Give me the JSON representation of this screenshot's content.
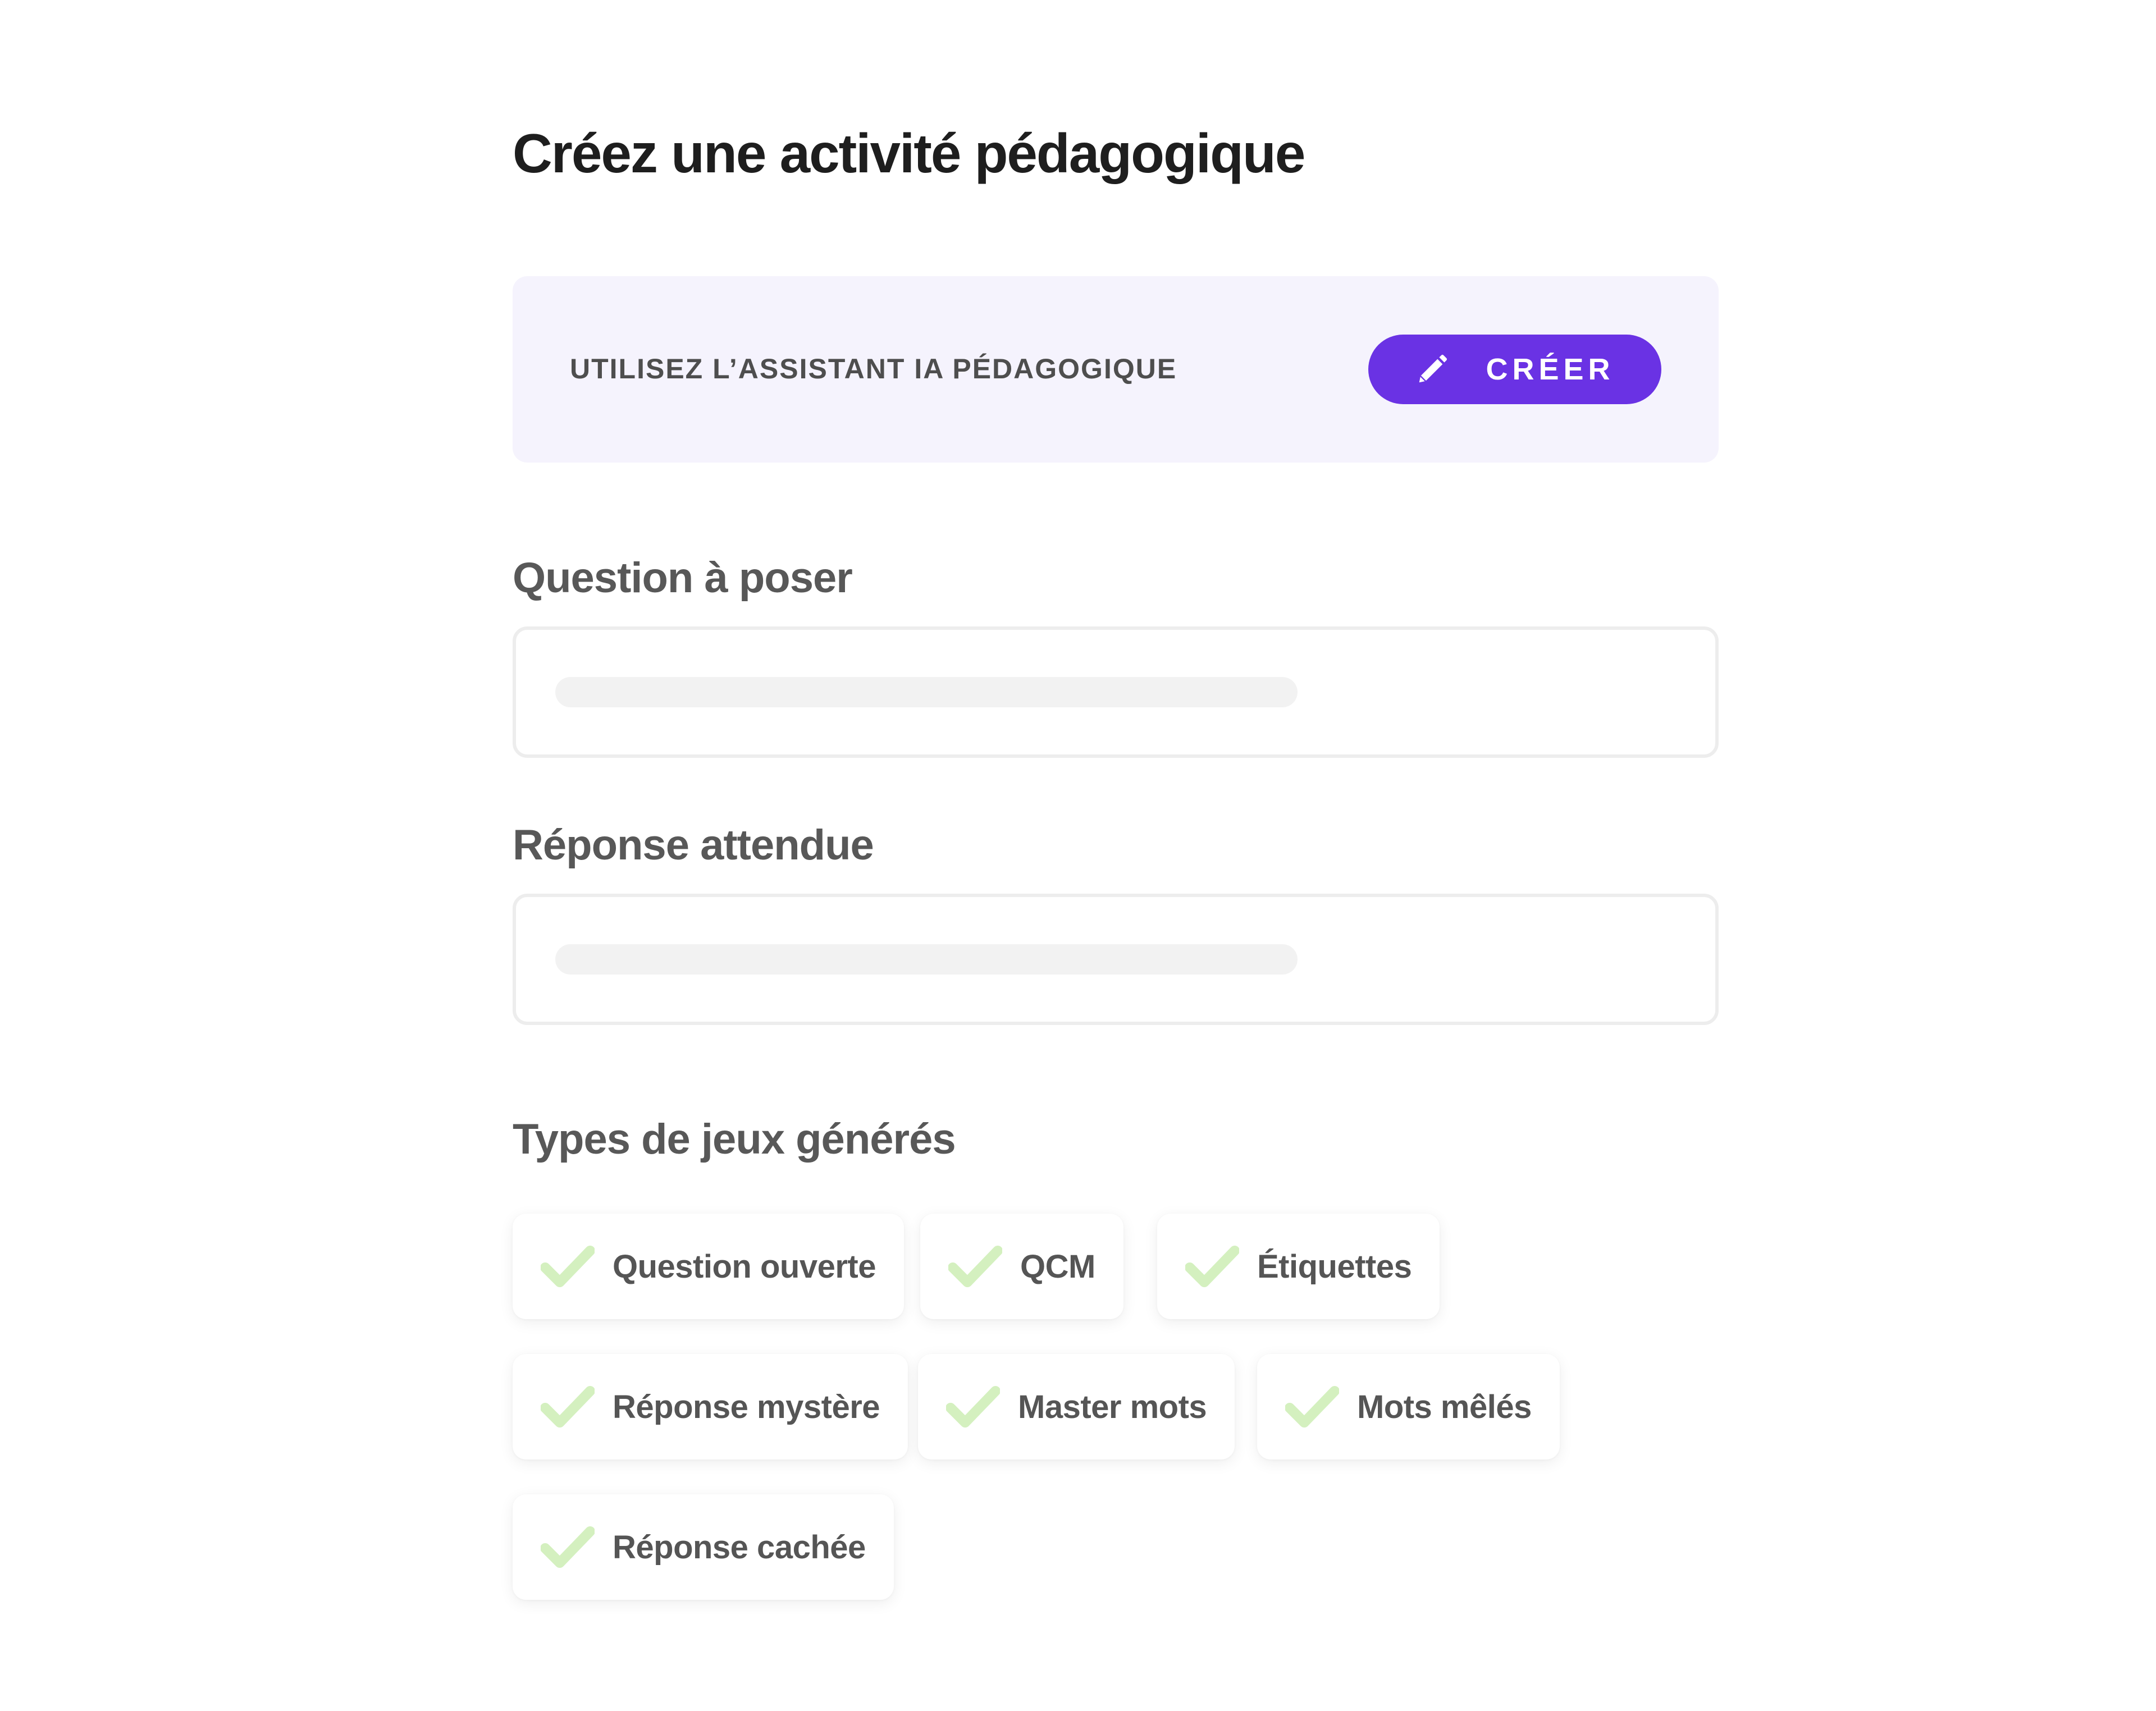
{
  "page": {
    "title": "Créez une activité pédagogique"
  },
  "assistant": {
    "label": "UTILISEZ L’ASSISTANT IA PÉDAGOGIQUE",
    "button_label": "CRÉER",
    "button_icon": "pencil-icon",
    "accent_color": "#6a32e4",
    "background_color": "#f5f3fd"
  },
  "form": {
    "question": {
      "label": "Question à poser",
      "value": "",
      "placeholder": ""
    },
    "answer": {
      "label": "Réponse attendue",
      "value": "",
      "placeholder": ""
    }
  },
  "game_types": {
    "label": "Types de jeux générés",
    "check_icon": "checkmark-icon",
    "check_color": "#d4f0bf",
    "items": [
      {
        "label": "Question ouverte",
        "selected": true
      },
      {
        "label": "QCM",
        "selected": true
      },
      {
        "label": "Étiquettes",
        "selected": true
      },
      {
        "label": "Réponse mystère",
        "selected": true
      },
      {
        "label": "Master mots",
        "selected": true
      },
      {
        "label": "Mots mêlés",
        "selected": true
      },
      {
        "label": "Réponse cachée",
        "selected": true
      }
    ]
  }
}
